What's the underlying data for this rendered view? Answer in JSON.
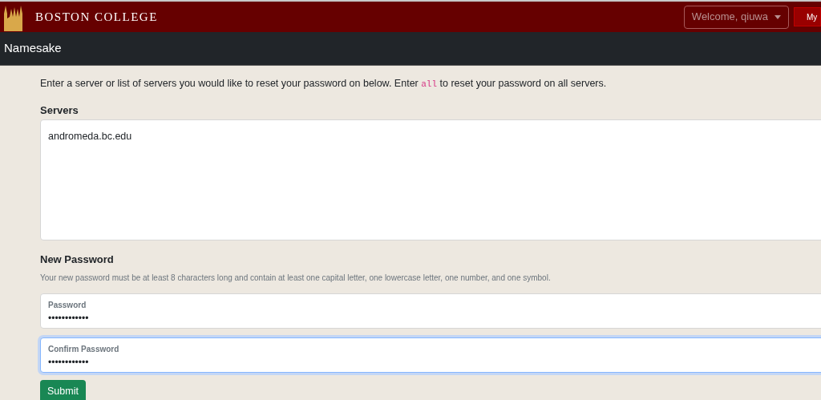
{
  "header": {
    "logo_text": "BOSTON COLLEGE",
    "user_menu": "Welcome, qiuwa",
    "cut_button": "My"
  },
  "navbar": {
    "title": "Namesake"
  },
  "intro": {
    "before": "Enter a server or list of servers you would like to reset your password on below. Enter ",
    "code": "all",
    "after": " to reset your password on all servers."
  },
  "servers": {
    "label": "Servers",
    "value": "andromeda.bc.edu"
  },
  "new_password": {
    "heading": "New Password",
    "help": "Your new password must be at least 8 characters long and contain at least one capital letter, one lowercase letter, one number, and one symbol."
  },
  "fields": [
    {
      "label": "Password",
      "value": "••••••••••••",
      "focused": false
    },
    {
      "label": "Confirm Password",
      "value": "••••••••••••",
      "focused": true
    }
  ],
  "submit": "Submit"
}
